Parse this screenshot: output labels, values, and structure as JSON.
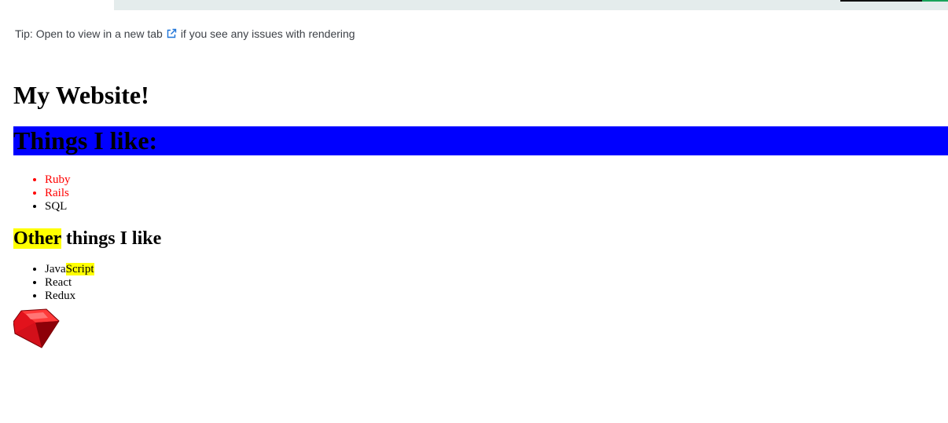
{
  "tip": {
    "before": "Tip: Open to view in a new tab",
    "after": "if you see any issues with rendering",
    "icon": "external-link-icon"
  },
  "page": {
    "title": "My Website!",
    "things_heading": "Things I like:",
    "things": [
      {
        "label": "Ruby",
        "color": "#ff0000"
      },
      {
        "label": "Rails",
        "color": "#ff0000"
      },
      {
        "label": "SQL",
        "color": "#000000"
      }
    ],
    "other_heading_highlight": "Other",
    "other_heading_rest": " things I like",
    "other_things": [
      {
        "prefix": "Java",
        "highlight": "Script"
      },
      {
        "label": "React"
      },
      {
        "label": "Redux"
      }
    ],
    "image": "ruby-gem-logo"
  },
  "colors": {
    "heading_band": "#0000ff",
    "highlight": "#ffff00",
    "red_items": "#ff0000"
  }
}
